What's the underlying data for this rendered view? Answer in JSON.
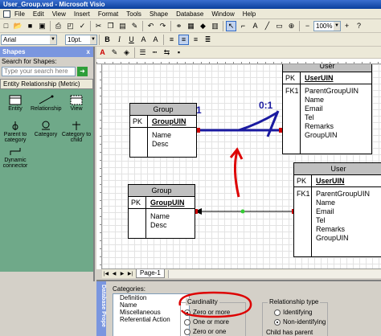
{
  "app": {
    "title": "User_Group.vsd - Microsoft Visio"
  },
  "menu": [
    "File",
    "Edit",
    "View",
    "Insert",
    "Format",
    "Tools",
    "Shape",
    "Database",
    "Window",
    "Help"
  ],
  "toolbar": {
    "zoom": "100%"
  },
  "format": {
    "font": "Arial",
    "size": "10pt."
  },
  "shapes_panel": {
    "title": "Shapes",
    "close": "x",
    "search_label": "Search for Shapes:",
    "search_placeholder": "Type your search here",
    "stencil": "Entity Relationship (Metric)",
    "masters": [
      {
        "label": "Entity"
      },
      {
        "label": "Relationship"
      },
      {
        "label": "View"
      },
      {
        "label": "Parent to category"
      },
      {
        "label": "Category"
      },
      {
        "label": "Category to child"
      },
      {
        "label": "Dynamic connector"
      }
    ]
  },
  "diagram": {
    "group1": {
      "title": "Group",
      "pk": "PK",
      "key_field": "GroupUIN",
      "fields": [
        "Name",
        "Desc"
      ]
    },
    "group2": {
      "title": "Group",
      "pk": "PK",
      "key_field": "GroupUIN",
      "fields": [
        "Name",
        "Desc"
      ]
    },
    "user1": {
      "title": "User",
      "pk": "PK",
      "key_field": "UserUIN",
      "fk": "FK1",
      "fields": [
        "ParentGroupUIN",
        "Name",
        "Email",
        "Tel",
        "Remarks",
        "GroupUIN"
      ]
    },
    "user2": {
      "title": "User",
      "pk": "PK",
      "key_field": "UserUIN",
      "fk": "FK1",
      "fields": [
        "ParentGroupUIN",
        "Name",
        "Email",
        "Tel",
        "Remarks",
        "GroupUIN"
      ]
    },
    "annotation_one": "1",
    "annotation_zero_one": "0:1"
  },
  "page_tab": "Page-1",
  "properties": {
    "side_title": "Database Prope",
    "categories_label": "Categories:",
    "categories": [
      "Definition",
      "Name",
      "Miscellaneous",
      "Referential Action"
    ],
    "cardinality_label": "Cardinality",
    "cardinality_options": [
      "Zero or more",
      "One or more",
      "Zero or one"
    ],
    "relationship_label": "Relationship type",
    "relationship_options": [
      "Identifying",
      "Non-identifying"
    ],
    "child_has_parent": "Child has parent"
  }
}
